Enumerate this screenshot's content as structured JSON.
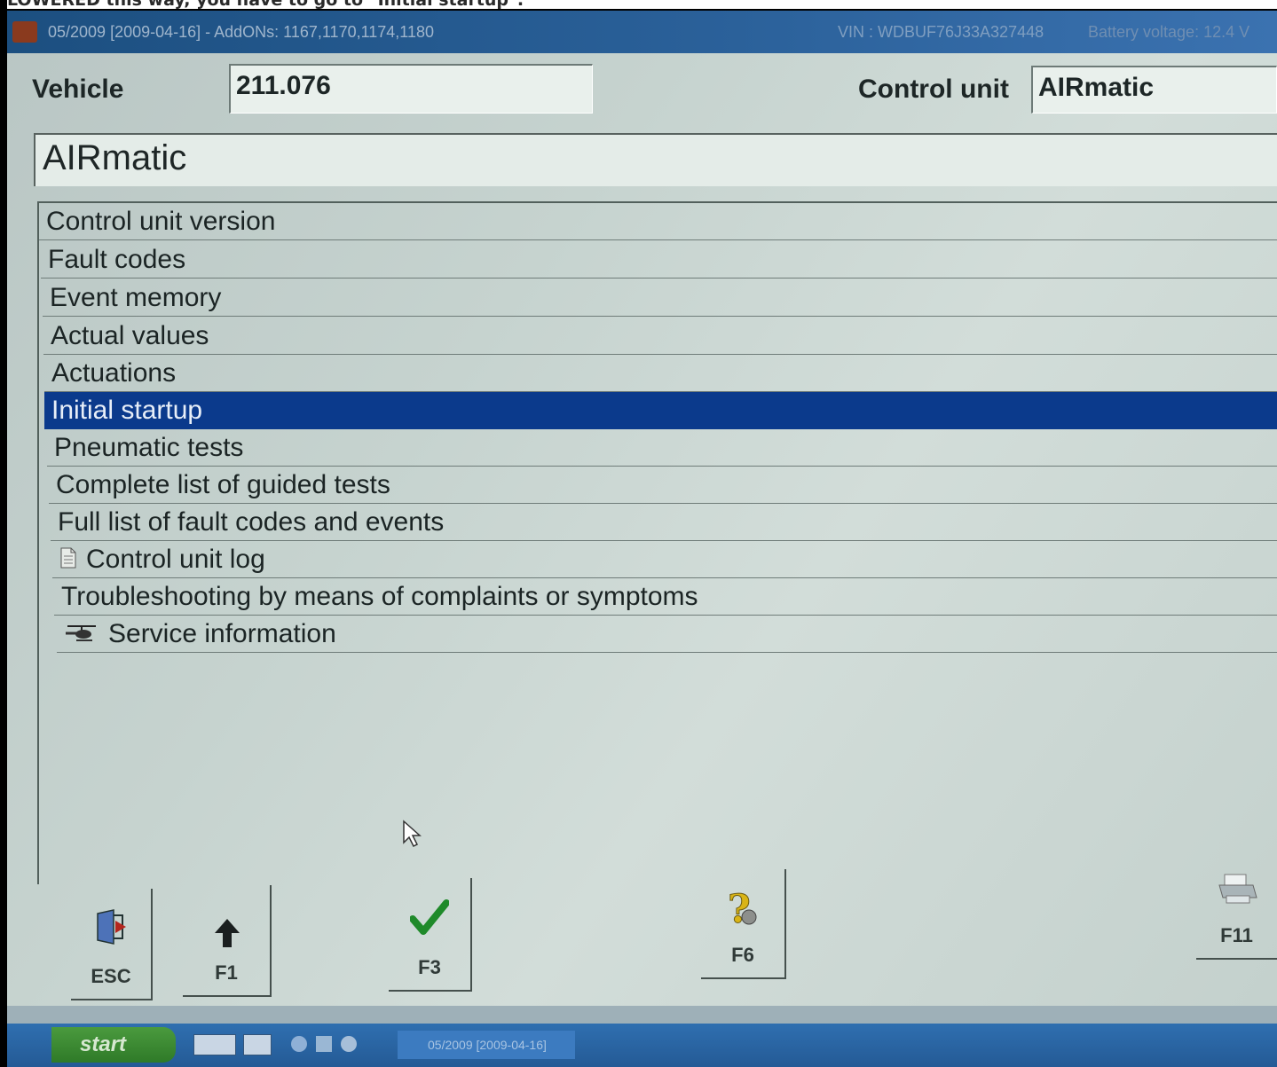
{
  "caption": "LOWERED this way, you have to go to \"Initial startup\".",
  "window": {
    "title": "05/2009 [2009-04-16] - AddONs: 1167,1170,1174,1180",
    "vin": "VIN : WDBUF76J33A327448",
    "battery": "Battery voltage: 12.4 V"
  },
  "vehicle": {
    "label": "Vehicle",
    "value": "211.076"
  },
  "control_unit": {
    "label": "Control unit",
    "value": "AIRmatic"
  },
  "heading": "AIRmatic",
  "menu": {
    "items": [
      {
        "label": "Control unit version"
      },
      {
        "label": "Fault codes"
      },
      {
        "label": "Event memory"
      },
      {
        "label": "Actual values"
      },
      {
        "label": "Actuations"
      },
      {
        "label": "Initial startup",
        "selected": true
      },
      {
        "label": "Pneumatic tests"
      },
      {
        "label": "Complete list of guided tests"
      },
      {
        "label": "Full list of fault codes and events"
      },
      {
        "label": "Control unit log",
        "icon": "document-icon"
      },
      {
        "label": "Troubleshooting by means of complaints or symptoms"
      },
      {
        "label": "Service information",
        "icon": "helicopter-icon"
      }
    ]
  },
  "function_keys": [
    {
      "label": "ESC",
      "icon": "exit-door-icon"
    },
    {
      "label": "F1",
      "icon": "up-arrow-icon"
    },
    {
      "label": "F3",
      "icon": "checkmark-icon"
    },
    {
      "label": "F6",
      "icon": "help-question-icon"
    },
    {
      "label": "F11",
      "icon": "printer-icon"
    }
  ],
  "taskbar": {
    "start_label": "start",
    "task_label": "05/2009 [2009-04-16]"
  },
  "colors": {
    "selection": "#0b3a8c",
    "titlebar": "#2a6099",
    "screen_bg": "#c6d3cf"
  }
}
